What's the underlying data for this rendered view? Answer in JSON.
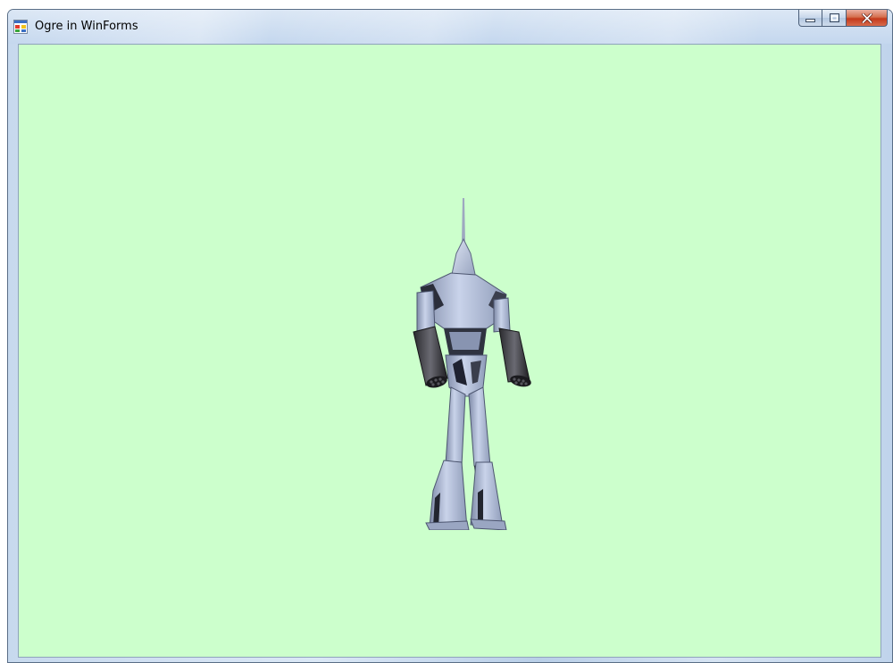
{
  "window": {
    "title": "Ogre in WinForms",
    "app_icon": "winforms-app-icon",
    "caption_buttons": [
      "minimize-icon",
      "maximize-icon",
      "close-icon"
    ]
  },
  "viewport": {
    "background_color": "#ccffcc",
    "scene_object": "robot-mesh"
  }
}
